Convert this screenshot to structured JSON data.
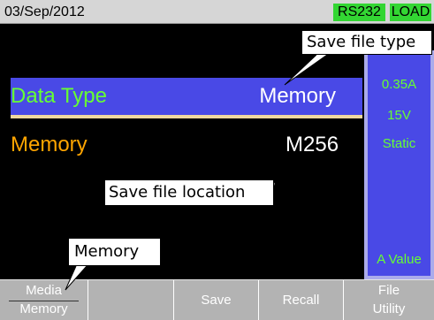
{
  "status_bar": {
    "date": "03/Sep/2012",
    "interface_badge": "RS232",
    "mode_badge": "LOAD"
  },
  "settings": {
    "data_type_label": "Data Type",
    "data_type_value": "Memory",
    "memory_label": "Memory",
    "memory_value": "M256"
  },
  "side_panel": {
    "current": "0.35A",
    "voltage": "15V",
    "mode": "Static",
    "unit": "A Value"
  },
  "softkeys": {
    "media_label": "Media",
    "media_value": "Memory",
    "blank": "",
    "save": "Save",
    "recall": "Recall",
    "file_line1": "File",
    "file_line2": "Utility"
  },
  "callouts": {
    "save_file_type": "Save file type",
    "save_file_location": "Save file location",
    "memory": "Memory"
  },
  "colors": {
    "highlight_row": "#4949e6",
    "badge_green": "#33d633",
    "label_green": "#66ff33",
    "label_orange": "#ffa500"
  }
}
